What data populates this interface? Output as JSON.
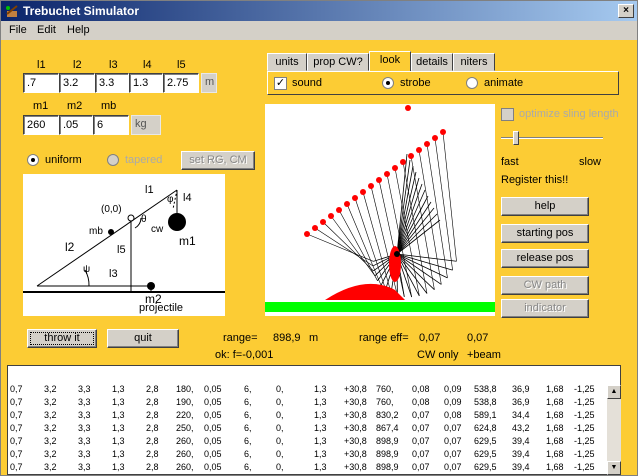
{
  "window": {
    "title": "Trebuchet Simulator",
    "close": "×"
  },
  "menu": [
    "File",
    "Edit",
    "Help"
  ],
  "lengths": {
    "headers": [
      "l1",
      "l2",
      "l3",
      "l4",
      "l5"
    ],
    "values": [
      ".7",
      "3.2",
      "3.3",
      "1.3",
      "2.75"
    ],
    "unit": "m"
  },
  "masses": {
    "headers": [
      "m1",
      "m2",
      "mb"
    ],
    "values": [
      "260",
      ".05",
      "6"
    ],
    "unit": "kg"
  },
  "beam": {
    "uniform": "uniform",
    "tapered": "tapered",
    "set_button": "set RG, CM",
    "selected": "uniform"
  },
  "tabs": [
    "units",
    "prop CW?",
    "look",
    "details",
    "niters"
  ],
  "active_tab": "look",
  "look": {
    "sound": "sound",
    "strobe": "strobe",
    "animate": "animate",
    "sound_checked": true,
    "mode": "strobe"
  },
  "side": {
    "optimize": "optimize sling length",
    "fast": "fast",
    "slow": "slow",
    "register": "Register this!!",
    "help": "help",
    "starting_pos": "starting pos",
    "release_pos": "release pos",
    "cw_path": "CW path",
    "indicator": "indicator"
  },
  "diagram": {
    "origin": "(0,0)",
    "l1": "l1",
    "phi": "φ",
    "l4": "l4",
    "theta": "θ",
    "cw": "cw",
    "m1": "m1",
    "mb": "mb",
    "l2": "l2",
    "l5": "l5",
    "psi": "ψ",
    "l3": "l3",
    "m2": "m2",
    "projectile": "projectile"
  },
  "controls": {
    "throw": "throw it",
    "quit": "quit"
  },
  "results": {
    "range_label": "range=",
    "range_value": "898,9",
    "range_unit": "m",
    "range_eff_label": "range  eff=",
    "eff1": "0,07",
    "eff2": "0,07",
    "ok_label": "ok:  f=-0,001",
    "cw_only": "CW only",
    "beam": "+beam"
  },
  "table": [
    [
      "0,7",
      "3,2",
      "3,3",
      "1,3",
      "2,8",
      "180,",
      "0,05",
      "6,",
      "0,",
      "1,3",
      "+30,8",
      "760,",
      "0,08",
      "0,09",
      "538,8",
      "36,9",
      "1,68",
      "-1,25"
    ],
    [
      "0,7",
      "3,2",
      "3,3",
      "1,3",
      "2,8",
      "190,",
      "0,05",
      "6,",
      "0,",
      "1,3",
      "+30,8",
      "760,",
      "0,08",
      "0,09",
      "538,8",
      "36,9",
      "1,68",
      "-1,25"
    ],
    [
      "0,7",
      "3,2",
      "3,3",
      "1,3",
      "2,8",
      "220,",
      "0,05",
      "6,",
      "0,",
      "1,3",
      "+30,8",
      "830,2",
      "0,07",
      "0,08",
      "589,1",
      "34,4",
      "1,68",
      "-1,25"
    ],
    [
      "0,7",
      "3,2",
      "3,3",
      "1,3",
      "2,8",
      "250,",
      "0,05",
      "6,",
      "0,",
      "1,3",
      "+30,8",
      "867,4",
      "0,07",
      "0,07",
      "624,8",
      "43,2",
      "1,68",
      "-1,25"
    ],
    [
      "0,7",
      "3,2",
      "3,3",
      "1,3",
      "2,8",
      "260,",
      "0,05",
      "6,",
      "0,",
      "1,3",
      "+30,8",
      "898,9",
      "0,07",
      "0,07",
      "629,5",
      "39,4",
      "1,68",
      "-1,25"
    ],
    [
      "0,7",
      "3,2",
      "3,3",
      "1,3",
      "2,8",
      "260,",
      "0,05",
      "6,",
      "0,",
      "1,3",
      "+30,8",
      "898,9",
      "0,07",
      "0,07",
      "629,5",
      "39,4",
      "1,68",
      "-1,25"
    ],
    [
      "0,7",
      "3,2",
      "3,3",
      "1,3",
      "2,8",
      "260,",
      "0,05",
      "6,",
      "0,",
      "1,3",
      "+30,8",
      "898,9",
      "0,07",
      "0,07",
      "629,5",
      "39,4",
      "1,68",
      "-1,25"
    ]
  ],
  "colors": {
    "background": "#fccc34",
    "ground": "#00ff00",
    "projectile": "#ff0000"
  }
}
